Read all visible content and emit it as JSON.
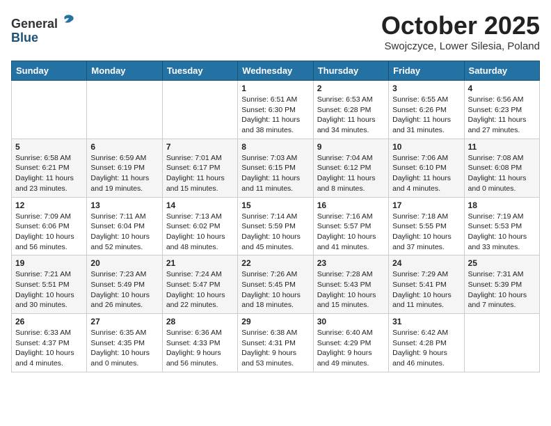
{
  "header": {
    "logo_line1": "General",
    "logo_line2": "Blue",
    "month_title": "October 2025",
    "location": "Swojczyce, Lower Silesia, Poland"
  },
  "days_of_week": [
    "Sunday",
    "Monday",
    "Tuesday",
    "Wednesday",
    "Thursday",
    "Friday",
    "Saturday"
  ],
  "weeks": [
    [
      {
        "day": "",
        "info": ""
      },
      {
        "day": "",
        "info": ""
      },
      {
        "day": "",
        "info": ""
      },
      {
        "day": "1",
        "info": "Sunrise: 6:51 AM\nSunset: 6:30 PM\nDaylight: 11 hours\nand 38 minutes."
      },
      {
        "day": "2",
        "info": "Sunrise: 6:53 AM\nSunset: 6:28 PM\nDaylight: 11 hours\nand 34 minutes."
      },
      {
        "day": "3",
        "info": "Sunrise: 6:55 AM\nSunset: 6:26 PM\nDaylight: 11 hours\nand 31 minutes."
      },
      {
        "day": "4",
        "info": "Sunrise: 6:56 AM\nSunset: 6:23 PM\nDaylight: 11 hours\nand 27 minutes."
      }
    ],
    [
      {
        "day": "5",
        "info": "Sunrise: 6:58 AM\nSunset: 6:21 PM\nDaylight: 11 hours\nand 23 minutes."
      },
      {
        "day": "6",
        "info": "Sunrise: 6:59 AM\nSunset: 6:19 PM\nDaylight: 11 hours\nand 19 minutes."
      },
      {
        "day": "7",
        "info": "Sunrise: 7:01 AM\nSunset: 6:17 PM\nDaylight: 11 hours\nand 15 minutes."
      },
      {
        "day": "8",
        "info": "Sunrise: 7:03 AM\nSunset: 6:15 PM\nDaylight: 11 hours\nand 11 minutes."
      },
      {
        "day": "9",
        "info": "Sunrise: 7:04 AM\nSunset: 6:12 PM\nDaylight: 11 hours\nand 8 minutes."
      },
      {
        "day": "10",
        "info": "Sunrise: 7:06 AM\nSunset: 6:10 PM\nDaylight: 11 hours\nand 4 minutes."
      },
      {
        "day": "11",
        "info": "Sunrise: 7:08 AM\nSunset: 6:08 PM\nDaylight: 11 hours\nand 0 minutes."
      }
    ],
    [
      {
        "day": "12",
        "info": "Sunrise: 7:09 AM\nSunset: 6:06 PM\nDaylight: 10 hours\nand 56 minutes."
      },
      {
        "day": "13",
        "info": "Sunrise: 7:11 AM\nSunset: 6:04 PM\nDaylight: 10 hours\nand 52 minutes."
      },
      {
        "day": "14",
        "info": "Sunrise: 7:13 AM\nSunset: 6:02 PM\nDaylight: 10 hours\nand 48 minutes."
      },
      {
        "day": "15",
        "info": "Sunrise: 7:14 AM\nSunset: 5:59 PM\nDaylight: 10 hours\nand 45 minutes."
      },
      {
        "day": "16",
        "info": "Sunrise: 7:16 AM\nSunset: 5:57 PM\nDaylight: 10 hours\nand 41 minutes."
      },
      {
        "day": "17",
        "info": "Sunrise: 7:18 AM\nSunset: 5:55 PM\nDaylight: 10 hours\nand 37 minutes."
      },
      {
        "day": "18",
        "info": "Sunrise: 7:19 AM\nSunset: 5:53 PM\nDaylight: 10 hours\nand 33 minutes."
      }
    ],
    [
      {
        "day": "19",
        "info": "Sunrise: 7:21 AM\nSunset: 5:51 PM\nDaylight: 10 hours\nand 30 minutes."
      },
      {
        "day": "20",
        "info": "Sunrise: 7:23 AM\nSunset: 5:49 PM\nDaylight: 10 hours\nand 26 minutes."
      },
      {
        "day": "21",
        "info": "Sunrise: 7:24 AM\nSunset: 5:47 PM\nDaylight: 10 hours\nand 22 minutes."
      },
      {
        "day": "22",
        "info": "Sunrise: 7:26 AM\nSunset: 5:45 PM\nDaylight: 10 hours\nand 18 minutes."
      },
      {
        "day": "23",
        "info": "Sunrise: 7:28 AM\nSunset: 5:43 PM\nDaylight: 10 hours\nand 15 minutes."
      },
      {
        "day": "24",
        "info": "Sunrise: 7:29 AM\nSunset: 5:41 PM\nDaylight: 10 hours\nand 11 minutes."
      },
      {
        "day": "25",
        "info": "Sunrise: 7:31 AM\nSunset: 5:39 PM\nDaylight: 10 hours\nand 7 minutes."
      }
    ],
    [
      {
        "day": "26",
        "info": "Sunrise: 6:33 AM\nSunset: 4:37 PM\nDaylight: 10 hours\nand 4 minutes."
      },
      {
        "day": "27",
        "info": "Sunrise: 6:35 AM\nSunset: 4:35 PM\nDaylight: 10 hours\nand 0 minutes."
      },
      {
        "day": "28",
        "info": "Sunrise: 6:36 AM\nSunset: 4:33 PM\nDaylight: 9 hours\nand 56 minutes."
      },
      {
        "day": "29",
        "info": "Sunrise: 6:38 AM\nSunset: 4:31 PM\nDaylight: 9 hours\nand 53 minutes."
      },
      {
        "day": "30",
        "info": "Sunrise: 6:40 AM\nSunset: 4:29 PM\nDaylight: 9 hours\nand 49 minutes."
      },
      {
        "day": "31",
        "info": "Sunrise: 6:42 AM\nSunset: 4:28 PM\nDaylight: 9 hours\nand 46 minutes."
      },
      {
        "day": "",
        "info": ""
      }
    ]
  ]
}
